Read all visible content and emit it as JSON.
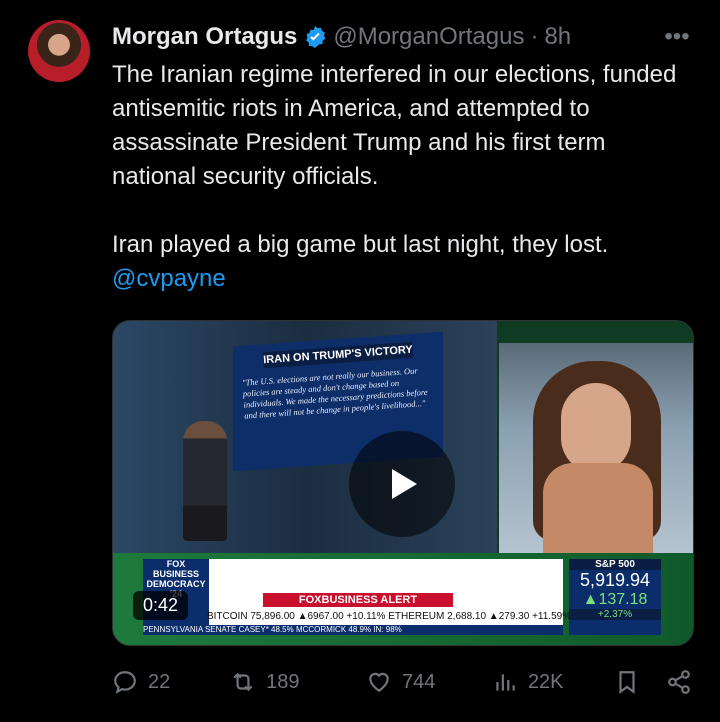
{
  "tweet": {
    "author_name": "Morgan Ortagus",
    "handle": "@MorganOrtagus",
    "separator": "·",
    "time": "8h",
    "more": "•••",
    "paragraph1": "The Iranian regime interfered in our elections, funded antisemitic riots in America, and attempted to assassinate President Trump and his first term national security officials.",
    "paragraph2": "Iran played a big game but last night, they lost.",
    "mention": "@cvpayne"
  },
  "video": {
    "duration": "0:42",
    "panel_title": "IRAN ON TRUMP'S VICTORY",
    "panel_quote": "\"The U.S. elections are not really our business. Our policies are steady and don't change based on individuals. We made the necessary predictions before and there will not be change in people's livelihood...\"",
    "show_badge": "FOX BUSINESS DEMOCRACY '24",
    "alert": "FOXBUSINESS ALERT",
    "ticker_row1": "BITCOIN 75,896.00 ▲6967.00 +10.11% ETHEREUM 2,688.10 ▲279.30 +11.59%",
    "ticker_row2": "PENNSYLVANIA SENATE CASEY* 48.5% MCCORMICK 48.9% IN: 98%",
    "sp_label": "S&P 500",
    "sp_value": "5,919.94",
    "sp_change": "▲137.18",
    "sp_pct": "+2.37%"
  },
  "actions": {
    "replies": "22",
    "retweets": "189",
    "likes": "744",
    "views": "22K"
  },
  "colors": {
    "background": "#000000",
    "text": "#e7e9ea",
    "muted": "#71767b",
    "link": "#1d9bf0",
    "verified": "#1d9bf0"
  },
  "icons": [
    "verified-badge-icon",
    "more-icon",
    "play-icon",
    "reply-icon",
    "retweet-icon",
    "like-icon",
    "views-icon",
    "bookmark-icon",
    "share-icon"
  ]
}
